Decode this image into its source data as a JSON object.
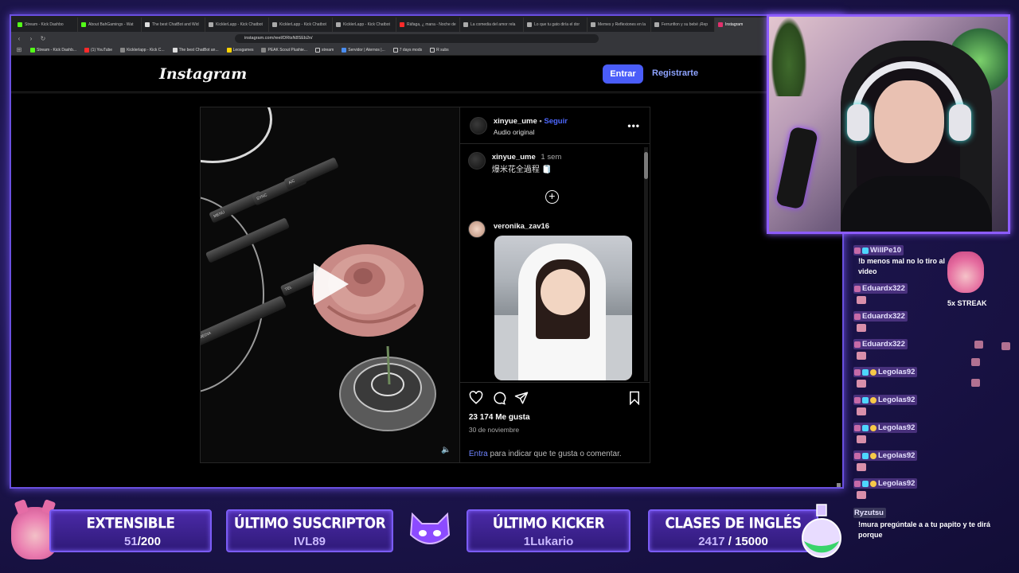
{
  "browser": {
    "tabs": [
      {
        "label": "Stream - Kick Dashbo"
      },
      {
        "label": "About BahGamings - Wat"
      },
      {
        "label": "The best ChatBot and Wid"
      },
      {
        "label": "KicklerLapp - Kick Chatbot"
      },
      {
        "label": "KicklerLapp - Kick Chatbot"
      },
      {
        "label": "KicklerLapp - Kick Chatbot"
      },
      {
        "label": "Ráfaga, ¿ mana - Noche de"
      },
      {
        "label": "La comedia del amor rela"
      },
      {
        "label": "Lo que tu gato diría el dor"
      },
      {
        "label": "Memes y Reflexiones en la"
      },
      {
        "label": "Ferrunfion y su bebé ¡Rep"
      },
      {
        "label": "Instagram"
      }
    ],
    "url": "instagram.com/reel/DRtsN8SEb2n/",
    "bookmarks": [
      "Stream - Kick Dashb...",
      "(1) YouTube",
      "Kicklerlapp - Kick C...",
      "The best ChatBot an...",
      "Leosgames",
      "PEAK Scout Plushie...",
      "stream",
      "Servidor | Aternos |...",
      "7 days mods",
      "R subs"
    ]
  },
  "instagram": {
    "logo": "Instagram",
    "login_label": "Entrar",
    "signup_label": "Registrarte",
    "post": {
      "author": "xinyue_ume",
      "dot": "•",
      "follow_label": "Seguir",
      "audio": "Audio original",
      "caption_user": "xinyue_ume",
      "caption_time": "1 sem",
      "caption_text": "爆米花全過程 🧻",
      "commenter": "veronika_zav16",
      "likes": "23 174 Me gusta",
      "date": "30 de noviembre",
      "login_link": "Entra",
      "login_hint": " para indicar que te gusta o comentar.",
      "console_labels": [
        "MENU",
        "SYNC",
        "A/C",
        "MEDIA",
        "TEL"
      ]
    }
  },
  "chat": {
    "messages": [
      {
        "user": "WillPe10",
        "text": "!b menos mal no lo tiro al video"
      },
      {
        "user": "Eduardx322"
      },
      {
        "user": "Eduardx322"
      },
      {
        "user": "Eduardx322"
      },
      {
        "user": "Legolas92"
      },
      {
        "user": "Legolas92"
      },
      {
        "user": "Legolas92"
      },
      {
        "user": "Legolas92"
      },
      {
        "user": "Legolas92"
      },
      {
        "user": "Ryzutsu",
        "text": "!mura pregúntale a a tu papito y te dirá porque"
      }
    ],
    "streak": "5x STREAK"
  },
  "overlay": {
    "extensible": {
      "title": "EXTENSIBLE",
      "current": "51",
      "goal": "200"
    },
    "ultimo_suscriptor": {
      "title": "ÚLTIMO SUSCRIPTOR",
      "value": "IVL89"
    },
    "ultimo_kicker": {
      "title": "ÚLTIMO KICKER",
      "value": "1Lukario"
    },
    "clases_ingles": {
      "title": "CLASES DE INGLÉS",
      "current": "2417",
      "goal": "15000"
    },
    "separator": "/"
  },
  "colors": {
    "accent": "#7b5cf5",
    "instagram_blue": "#4a5df9",
    "kick_green": "#53fc18"
  }
}
